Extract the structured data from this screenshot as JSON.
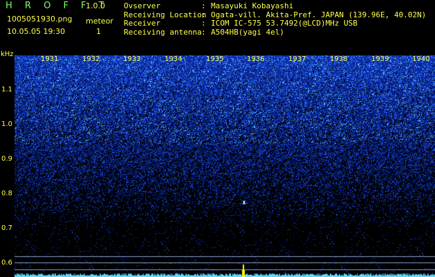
{
  "app": {
    "title": "H R O F F T",
    "version": "1.0.0",
    "filename": "1005051930.png",
    "datetime": "10.05.05 19:30",
    "meteor_label": "meteor",
    "meteor_count": "1"
  },
  "info": [
    {
      "label": "Ovserver",
      "value": "Masayuki Kobayashi"
    },
    {
      "label": "Receiving Location",
      "value": "Ogata-vill. Akita-Pref. JAPAN (139.96E, 40.02N)"
    },
    {
      "label": "Receiver",
      "value": "ICOM IC-575 53.7492(@LCD)MHz USB"
    },
    {
      "label": "Receiving antenna",
      "value": "A504HB(yagi 4el)"
    }
  ],
  "separator": ":",
  "y_axis": {
    "unit": "kHz",
    "ticks": [
      "1.1",
      "1.0",
      "0.9",
      "0.8",
      "0.7",
      "0.6"
    ]
  },
  "x_axis": {
    "ticks": [
      "1931",
      "1932",
      "1933",
      "1934",
      "1935",
      "1936",
      "1937",
      "1938",
      "1939",
      "1940"
    ]
  },
  "colors": {
    "label_yellow": "#ffff4d",
    "title_green": "#7dff6a",
    "noise_blue": "#2a4fff",
    "noise_cyan": "#5fd8ff",
    "reference_line": "#8aa0c8",
    "carrier_yellow": "#ffff00"
  }
}
